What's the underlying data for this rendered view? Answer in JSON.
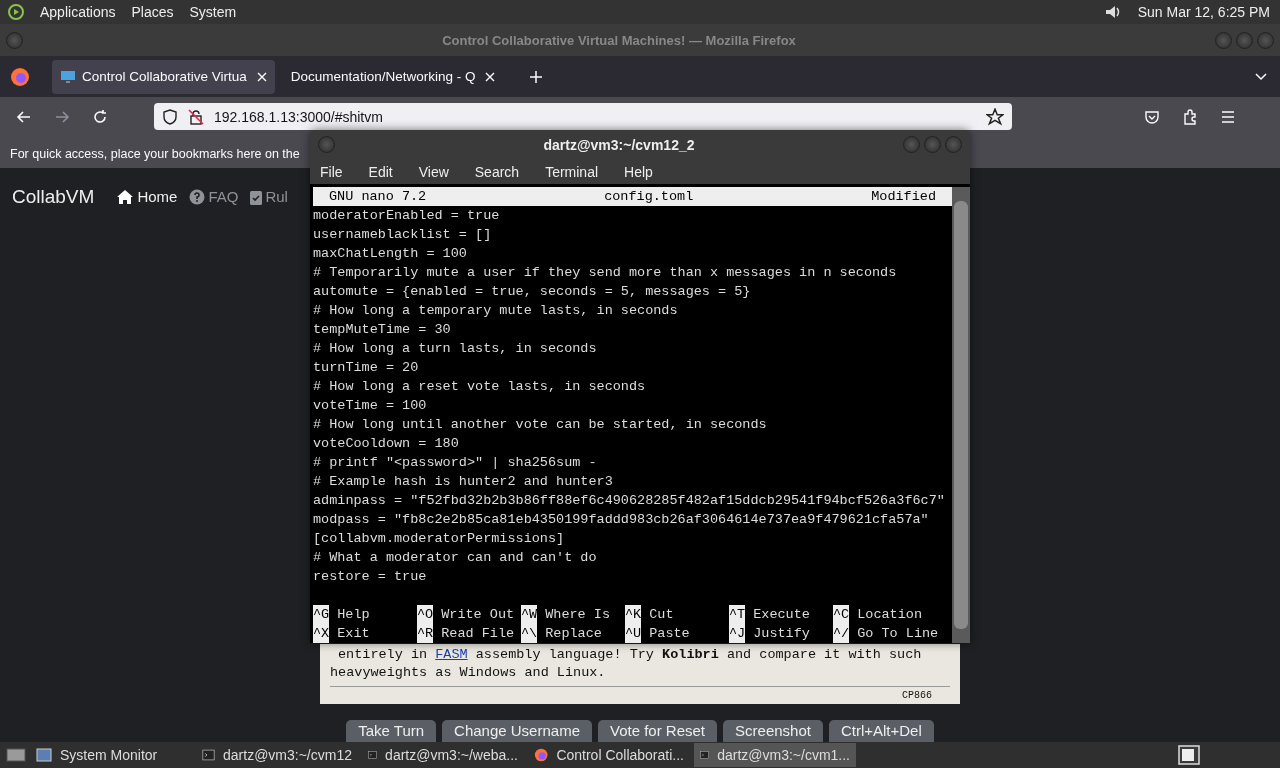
{
  "top_panel": {
    "menus": [
      "Applications",
      "Places",
      "System"
    ],
    "clock": "Sun Mar 12, 6:25 PM"
  },
  "browser": {
    "window_title": "Control Collaborative Virtual Machines! — Mozilla Firefox",
    "tabs": [
      {
        "label": "Control Collaborative Virtua",
        "selected": true
      },
      {
        "label": "Documentation/Networking - Q",
        "selected": false
      }
    ],
    "url": "192.168.1.13:3000/#shitvm",
    "bookmarks_hint": "For quick access, place your bookmarks here on the"
  },
  "page": {
    "brand": "CollabVM",
    "nav": [
      "Home",
      "FAQ",
      "Rul"
    ],
    "vm_screen": {
      "text_before_link": "entirely in",
      "link": "FASM",
      "text_after_link": "assembly language! Try **Kolibri** and compare it with such",
      "line_2": "heavyweights as Windows and Linux.",
      "footer": "CP866"
    },
    "buttons": [
      "Take Turn",
      "Change Username",
      "Vote for Reset",
      "Screenshot",
      "Ctrl+Alt+Del"
    ]
  },
  "terminal": {
    "title": "dartz@vm3:~/cvm12_2",
    "menu": [
      "File",
      "Edit",
      "View",
      "Search",
      "Terminal",
      "Help"
    ],
    "nano": {
      "version": "GNU nano 7.2",
      "file": "config.toml",
      "status": "Modified",
      "lines": [
        "moderatorEnabled = true",
        "usernameblacklist = []",
        "maxChatLength = 100",
        "# Temporarily mute a user if they send more than x messages in n seconds",
        "automute = {enabled = true, seconds = 5, messages = 5}",
        "# How long a temporary mute lasts, in seconds",
        "tempMuteTime = 30",
        "# How long a turn lasts, in seconds",
        "turnTime = 20",
        "# How long a reset vote lasts, in seconds",
        "voteTime = 100",
        "# How long until another vote can be started, in seconds",
        "voteCooldown = 180",
        "# printf \"<password>\" | sha256sum -",
        "# Example hash is hunter2 and hunter3",
        "adminpass = \"f52fbd32b2b3b86ff88ef6c490628285f482af15ddcb29541f94bcf526a3f6c7\"",
        "modpass = \"fb8c2e2b85ca81eb4350199faddd983cb26af3064614e737ea9f479621cfa57a\"",
        "[collabvm.moderatorPermissions]",
        "# What a moderator can and can't do",
        "restore = true"
      ],
      "shortcuts": [
        {
          "key": "^G",
          "label": "Help"
        },
        {
          "key": "^O",
          "label": "Write Out"
        },
        {
          "key": "^W",
          "label": "Where Is"
        },
        {
          "key": "^K",
          "label": "Cut"
        },
        {
          "key": "^T",
          "label": "Execute"
        },
        {
          "key": "^C",
          "label": "Location"
        },
        {
          "key": "^X",
          "label": "Exit"
        },
        {
          "key": "^R",
          "label": "Read File"
        },
        {
          "key": "^\\",
          "label": "Replace"
        },
        {
          "key": "^U",
          "label": "Paste"
        },
        {
          "key": "^J",
          "label": "Justify"
        },
        {
          "key": "^/",
          "label": "Go To Line"
        }
      ]
    }
  },
  "taskbar": {
    "items": [
      {
        "label": "System Monitor",
        "kind": "app",
        "selected": false
      },
      {
        "label": "dartz@vm3:~/cvm12",
        "kind": "terminal",
        "selected": false
      },
      {
        "label": "dartz@vm3:~/weba...",
        "kind": "terminal",
        "selected": false
      },
      {
        "label": "Control Collaborati...",
        "kind": "browser",
        "selected": false
      },
      {
        "label": "dartz@vm3:~/cvm1...",
        "kind": "terminal",
        "selected": true
      }
    ]
  }
}
